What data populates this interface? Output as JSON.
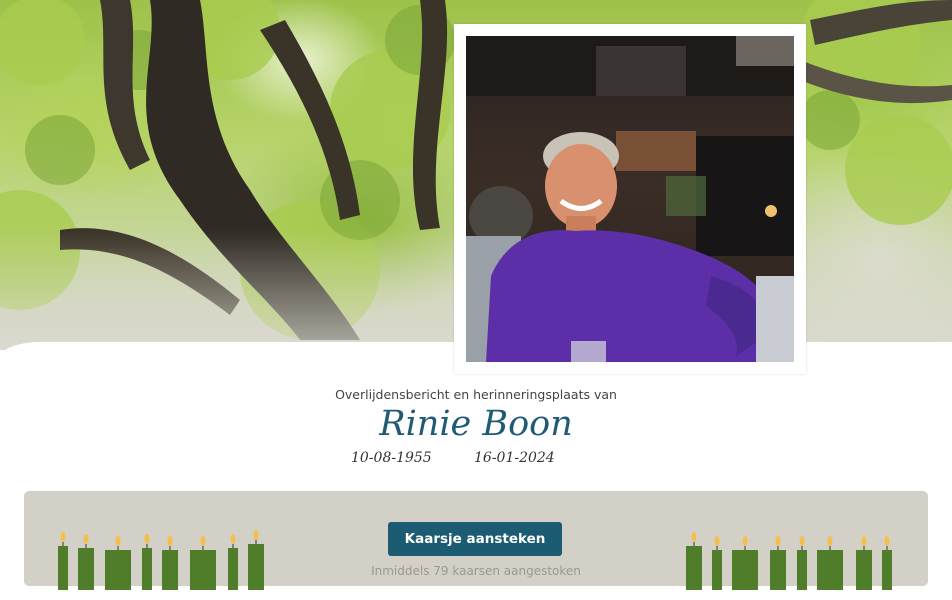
{
  "header": {
    "background_icon": "tree-canopy-photo"
  },
  "portrait": {
    "icon": "portrait-photo",
    "shirt_color": "#5c2fa8"
  },
  "intro": {
    "subtitle": "Overlijdensbericht en herinneringsplaats van",
    "name": "Rinie Boon",
    "birth_date": "10-08-1955",
    "death_date": "16-01-2024"
  },
  "candles": {
    "button_label": "Kaarsje aansteken",
    "count_text": "Inmiddels 79 kaarsen aangestoken",
    "candle_color": "#4f7d2a",
    "flame_icon": "candle-flame-icon",
    "accent": "#1c5c72"
  }
}
